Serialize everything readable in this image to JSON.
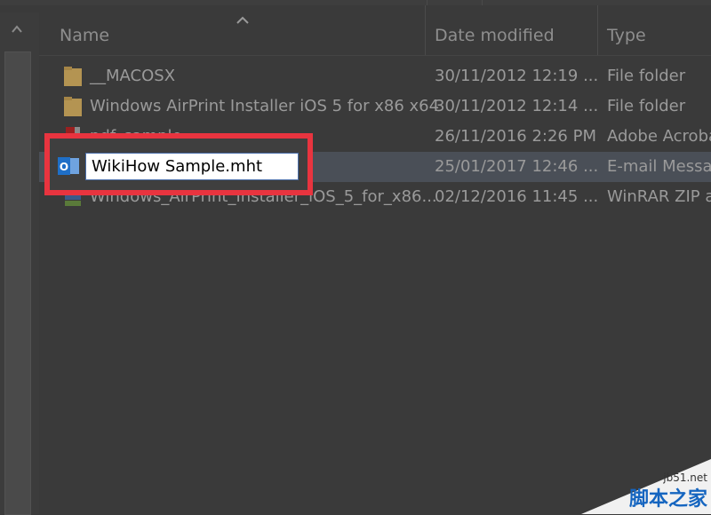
{
  "columns": {
    "name": "Name",
    "date_modified": "Date modified",
    "type": "Type"
  },
  "rows": [
    {
      "name": "__MACOSX",
      "date": "30/11/2012 12:19 ...",
      "type": "File folder",
      "icon": "folder-icon"
    },
    {
      "name": "Windows AirPrint Installer iOS 5 for x86 x64",
      "date": "30/11/2012 12:14 ...",
      "type": "File folder",
      "icon": "folder-icon"
    },
    {
      "name": "pdf_sample",
      "date": "26/11/2016 2:26 PM",
      "type": "Adobe Acroba",
      "icon": "pdf-icon"
    },
    {
      "name": "WikiHow Sample.mht",
      "date": "25/01/2017 12:46 ...",
      "type": "E-mail Messa",
      "icon": "outlook-icon"
    },
    {
      "name": "Windows_AirPrint_Installer_iOS_5_for_x86...",
      "date": "02/12/2016 11:45 ...",
      "type": "WinRAR ZIP a",
      "icon": "winrar-icon"
    }
  ],
  "rename_value": "WikiHow Sample.mht",
  "watermark": {
    "url": "jb51.net",
    "text": "脚本之家"
  },
  "colors": {
    "highlight": "#e8343f",
    "folder": "#d8b360"
  }
}
